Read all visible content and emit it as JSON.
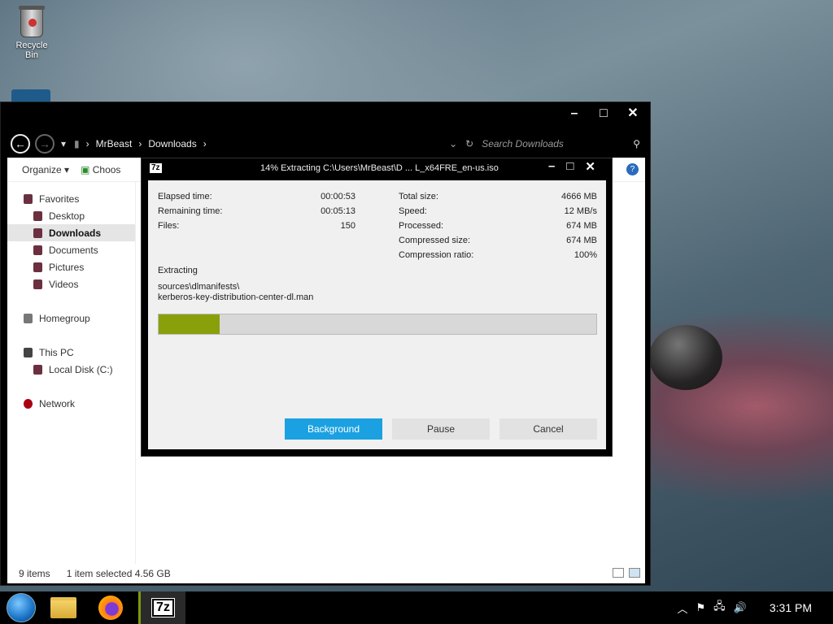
{
  "desktop": {
    "recycle_bin_label": "Recycle Bin"
  },
  "explorer": {
    "breadcrumb": [
      "MrBeast",
      "Downloads"
    ],
    "search_placeholder": "Search Downloads",
    "toolbar": {
      "organize": "Organize ▾",
      "choose": "Choos"
    },
    "nav": {
      "favorites": "Favorites",
      "desktop": "Desktop",
      "downloads": "Downloads",
      "documents": "Documents",
      "pictures": "Pictures",
      "videos": "Videos",
      "homegroup": "Homegroup",
      "this_pc": "This PC",
      "local_disk": "Local Disk (C:)",
      "network": "Network"
    },
    "status": {
      "items": "9 items",
      "selected": "1 item selected  4.56 GB"
    }
  },
  "dialog": {
    "logo": "7z",
    "title": "14% Extracting C:\\Users\\MrBeast\\D ... L_x64FRE_en-us.iso",
    "stats_left": [
      {
        "label": "Elapsed time:",
        "value": "00:00:53"
      },
      {
        "label": "Remaining time:",
        "value": "00:05:13"
      },
      {
        "label": "Files:",
        "value": "150"
      }
    ],
    "stats_right": [
      {
        "label": "Total size:",
        "value": "4666 MB"
      },
      {
        "label": "Speed:",
        "value": "12 MB/s"
      },
      {
        "label": "Processed:",
        "value": "674 MB"
      },
      {
        "label": "Compressed size:",
        "value": "674 MB"
      },
      {
        "label": "Compression ratio:",
        "value": "100%"
      }
    ],
    "extracting_label": "Extracting",
    "current_path": "sources\\dlmanifests\\",
    "current_file": "kerberos-key-distribution-center-dl.man",
    "progress_percent": 14,
    "buttons": {
      "background": "Background",
      "pause": "Pause",
      "cancel": "Cancel"
    }
  },
  "taskbar": {
    "clock": "3:31 PM"
  },
  "colors": {
    "accent": "#1ba1e2",
    "progress": "#8aa00a"
  }
}
